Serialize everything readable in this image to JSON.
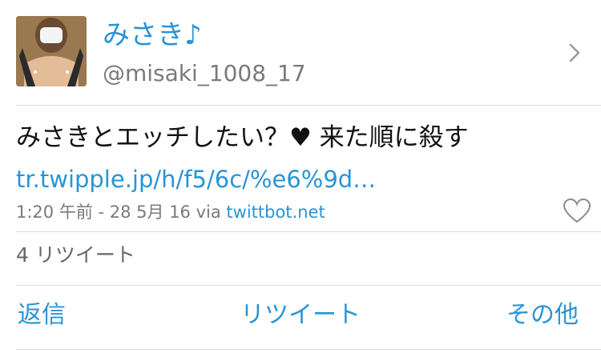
{
  "user": {
    "name": "みさき♪",
    "handle": "@misaki_1008_17"
  },
  "tweet": {
    "text": "みさきとエッチしたい？♥ 来た順に殺す",
    "link": "tr.twipple.jp/h/f5/6c/%e6%9d…",
    "time": "1:20 午前 - 28 5月 16 via",
    "source": "twittbot.net",
    "retweets": "4 リツイート"
  },
  "actions": {
    "reply": "返信",
    "retweet": "リツイート",
    "more": "その他"
  },
  "icons": {
    "chevron": "chevron-right-icon",
    "like": "heart-outline-icon"
  },
  "colors": {
    "accent": "#2a94d6",
    "secondary_text": "#7a7a7a",
    "divider": "#dcdcdc"
  }
}
